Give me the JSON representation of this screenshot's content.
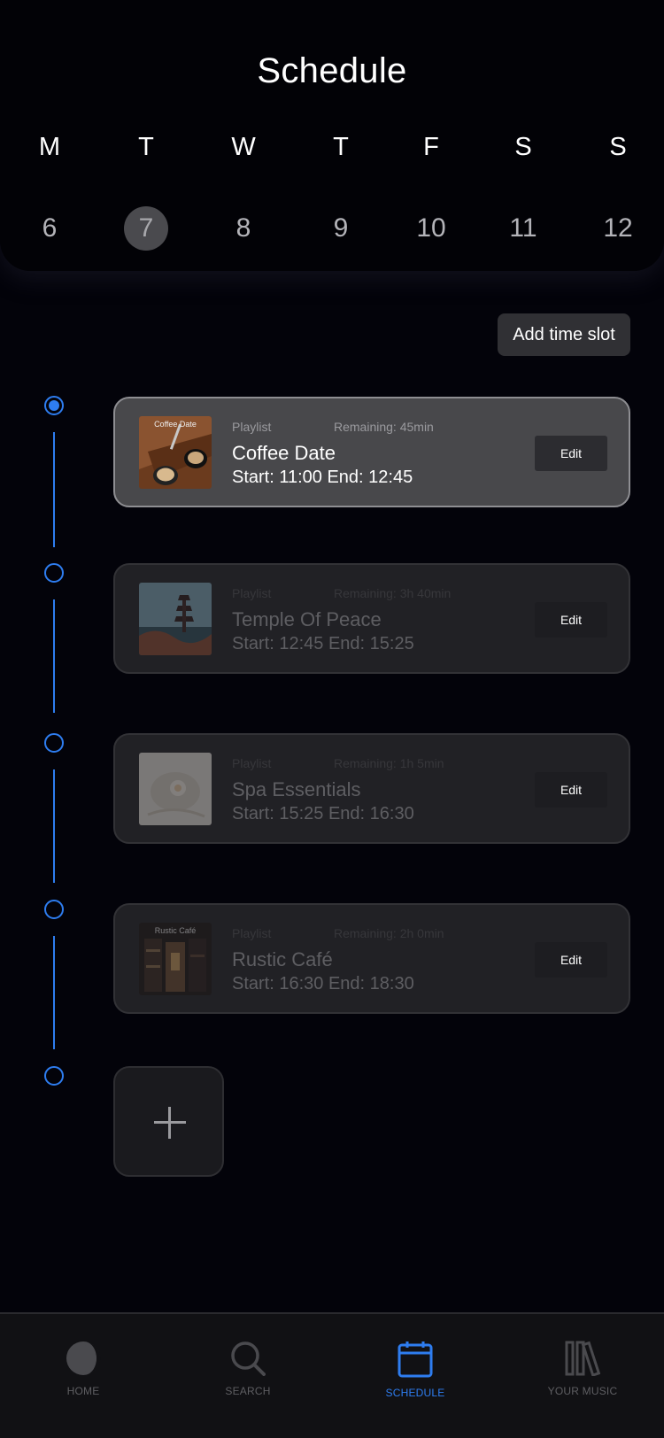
{
  "header": {
    "title": "Schedule",
    "weekdays": [
      "M",
      "T",
      "W",
      "T",
      "F",
      "S",
      "S"
    ],
    "dates": [
      "6",
      "7",
      "8",
      "9",
      "10",
      "11",
      "12"
    ],
    "selected_date": "7"
  },
  "actions": {
    "add_time_slot": "Add time slot"
  },
  "slots": [
    {
      "type": "Playlist",
      "remaining": "Remaining: 45min",
      "title": "Coffee Date",
      "times": "Start: 11:00  End: 12:45",
      "edit": "Edit",
      "thumb_label": "Coffee Date",
      "active": true
    },
    {
      "type": "Playlist",
      "remaining": "Remaining: 3h 40min",
      "title": "Temple Of Peace",
      "times": "Start: 12:45  End: 15:25",
      "edit": "Edit",
      "thumb_label": "",
      "active": false
    },
    {
      "type": "Playlist",
      "remaining": "Remaining: 1h 5min",
      "title": "Spa Essentials",
      "times": "Start: 15:25  End: 16:30",
      "edit": "Edit",
      "thumb_label": "",
      "active": false
    },
    {
      "type": "Playlist",
      "remaining": "Remaining: 2h 0min",
      "title": "Rustic Café",
      "times": "Start: 16:30  End: 18:30",
      "edit": "Edit",
      "thumb_label": "Rustic Café",
      "active": false
    }
  ],
  "add_card_icon": "plus-icon",
  "tabbar": {
    "tabs": [
      {
        "label": "HOME",
        "icon": "home-icon",
        "active": false
      },
      {
        "label": "SEARCH",
        "icon": "search-icon",
        "active": false
      },
      {
        "label": "SCHEDULE",
        "icon": "calendar-icon",
        "active": true
      },
      {
        "label": "YOUR MUSIC",
        "icon": "library-icon",
        "active": false
      }
    ]
  },
  "colors": {
    "accent": "#2e7df0",
    "background": "#03030a",
    "card": "#212125",
    "card_active": "#48484b"
  }
}
